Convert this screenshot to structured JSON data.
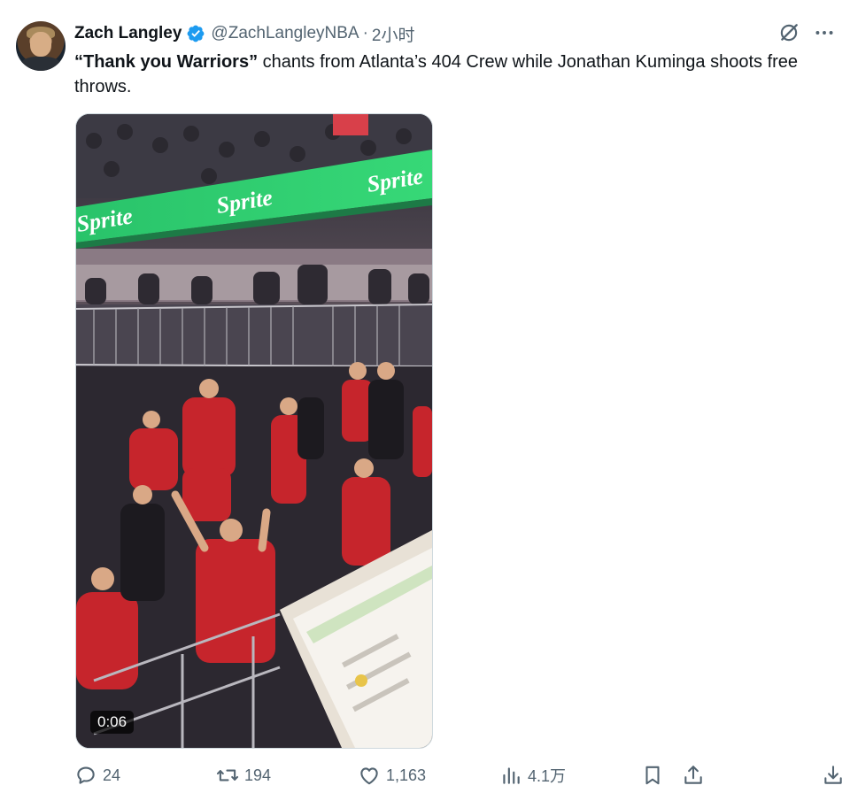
{
  "author": {
    "name": "Zach Langley",
    "handle": "@ZachLangleyNBA",
    "separator": "·",
    "time": "2小时",
    "verified": true
  },
  "tweet": {
    "text_bold": "“Thank you Warriors”",
    "text_rest": " chants from Atlanta’s 404 Crew while Jonathan Kuminga shoots free throws."
  },
  "media": {
    "duration": "0:06",
    "banner_text": "Sprite"
  },
  "actions": {
    "replies": "24",
    "reposts": "194",
    "likes": "1,163",
    "views": "4.1万"
  },
  "colors": {
    "accent": "#1d9bf0",
    "muted": "#536471",
    "text": "#0f1419",
    "border": "#cfd9de"
  },
  "icons": [
    "verified-icon",
    "grok-icon",
    "more-icon",
    "reply-icon",
    "repost-icon",
    "like-icon",
    "views-icon",
    "bookmark-icon",
    "share-icon",
    "download-icon"
  ]
}
